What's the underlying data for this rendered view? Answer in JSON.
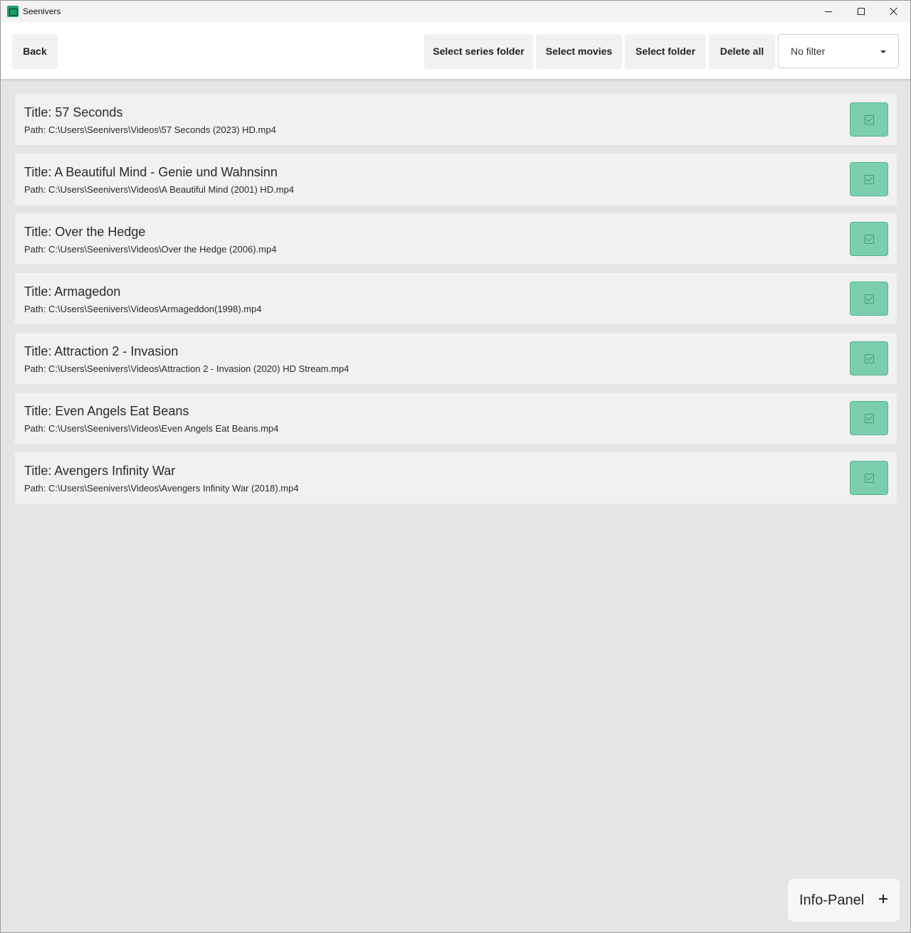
{
  "window": {
    "title": "Seenivers"
  },
  "toolbar": {
    "back_label": "Back",
    "select_series_folder_label": "Select series folder",
    "select_movies_label": "Select movies",
    "select_folder_label": "Select folder",
    "delete_all_label": "Delete all",
    "filter_selected": "No filter"
  },
  "items": [
    {
      "title": "Title: 57 Seconds",
      "path": "Path: C:\\Users\\Seenivers\\Videos\\57 Seconds (2023) HD.mp4"
    },
    {
      "title": "Title: A Beautiful Mind - Genie und Wahnsinn",
      "path": "Path: C:\\Users\\Seenivers\\Videos\\A Beautiful Mind (2001) HD.mp4"
    },
    {
      "title": "Title: Over the Hedge",
      "path": "Path: C:\\Users\\Seenivers\\Videos\\Over the Hedge (2006).mp4"
    },
    {
      "title": "Title: Armagedon",
      "path": "Path: C:\\Users\\Seenivers\\Videos\\Armageddon(1998).mp4"
    },
    {
      "title": "Title: Attraction 2 - Invasion",
      "path": "Path: C:\\Users\\Seenivers\\Videos\\Attraction 2 - Invasion (2020) HD Stream.mp4"
    },
    {
      "title": "Title: Even Angels Eat Beans",
      "path": "Path: C:\\Users\\Seenivers\\Videos\\Even Angels Eat Beans.mp4"
    },
    {
      "title": "Title: Avengers Infinity War",
      "path": "Path: C:\\Users\\Seenivers\\Videos\\Avengers Infinity War (2018).mp4"
    }
  ],
  "info_panel": {
    "label": "Info-Panel"
  },
  "colors": {
    "accent_green": "#7bcfae",
    "background": "#e4e5e4"
  },
  "icons": {
    "app": "app-icon",
    "confirm": "check-icon",
    "expand": "plus-icon"
  }
}
